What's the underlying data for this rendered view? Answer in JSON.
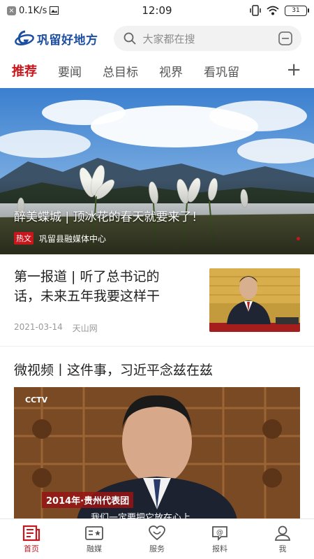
{
  "status_bar": {
    "network_speed": "0.1K/s",
    "time": "12:09",
    "battery": "31"
  },
  "header": {
    "logo_text": "巩留好地方",
    "search_placeholder": "大家都在搜"
  },
  "tabs": [
    {
      "label": "推荐",
      "active": true
    },
    {
      "label": "要闻",
      "active": false
    },
    {
      "label": "总目标",
      "active": false
    },
    {
      "label": "视界",
      "active": false
    },
    {
      "label": "看巩留",
      "active": false
    }
  ],
  "hero": {
    "title": "醉美蝶城 | 顶冰花的春天就要来了！",
    "tag": "热文",
    "source": "巩留县融媒体中心"
  },
  "articles": [
    {
      "title": "第一报道 | 听了总书记的话，未来五年我要这样干",
      "date": "2021-03-14",
      "source": "天山网"
    },
    {
      "title": "微视频丨这件事，习近平念兹在兹",
      "video_logo": "CCTV",
      "video_badge": "2014年·贵州代表团",
      "video_subtitle": "我们一定要把它放在心上"
    }
  ],
  "bottom_nav": [
    {
      "label": "首页",
      "icon": "home-news-icon",
      "active": true
    },
    {
      "label": "融媒",
      "icon": "media-icon",
      "active": false
    },
    {
      "label": "服务",
      "icon": "heart-service-icon",
      "active": false
    },
    {
      "label": "报料",
      "icon": "report-icon",
      "active": false
    },
    {
      "label": "我",
      "icon": "user-icon",
      "active": false
    }
  ],
  "colors": {
    "accent": "#c8161d",
    "logo_blue": "#1d4fa0"
  }
}
